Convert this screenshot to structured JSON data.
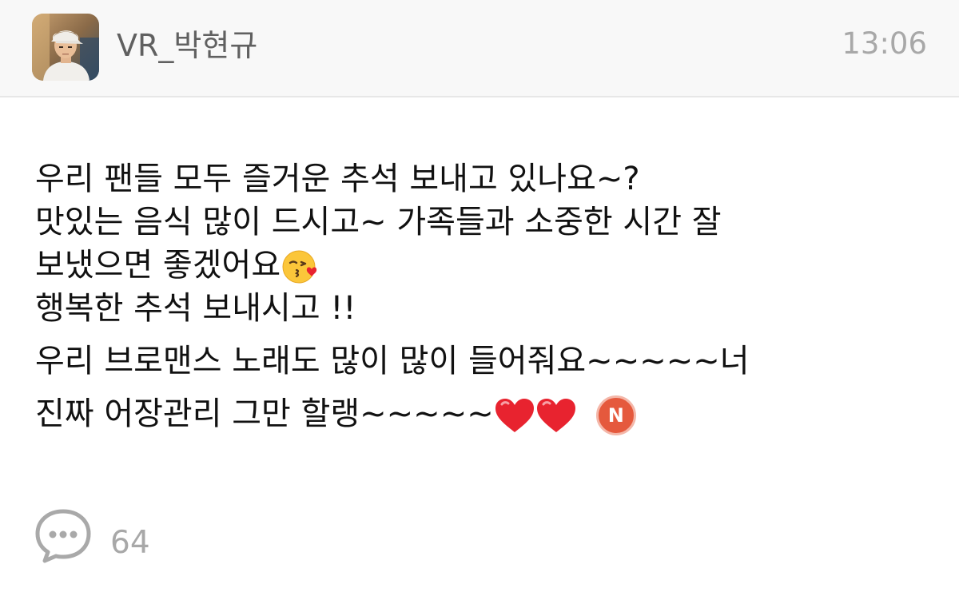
{
  "header": {
    "avatar_icon": "user-avatar-photo",
    "username": "VR_박현규",
    "time": "13:06"
  },
  "message": {
    "line1": "우리 팬들 모두 즐거운 추석 보내고 있나요~?",
    "line2": "맛있는 음식 많이 드시고~ 가족들과 소중한 시간 잘",
    "line3": "보냈으면 좋겠어요",
    "line4": "행복한 추석 보내시고 !!",
    "line5": "우리 브로맨스 노래도 많이 많이 들어줘요~~~~~너",
    "line6": "진짜 어장관리 그만 할랭~~~~~",
    "emoji_kiss": "kissing-face-heart-emoji",
    "emoji_heart": "red-heart-emoji",
    "badge_label": "N"
  },
  "footer": {
    "comment_icon": "speech-bubble-icon",
    "comment_count": "64"
  },
  "colors": {
    "header_bg": "#f8f8f8",
    "username": "#606060",
    "time": "#a8a8a8",
    "text": "#111111",
    "badge": "#e5593d",
    "heart": "#e8232f"
  }
}
